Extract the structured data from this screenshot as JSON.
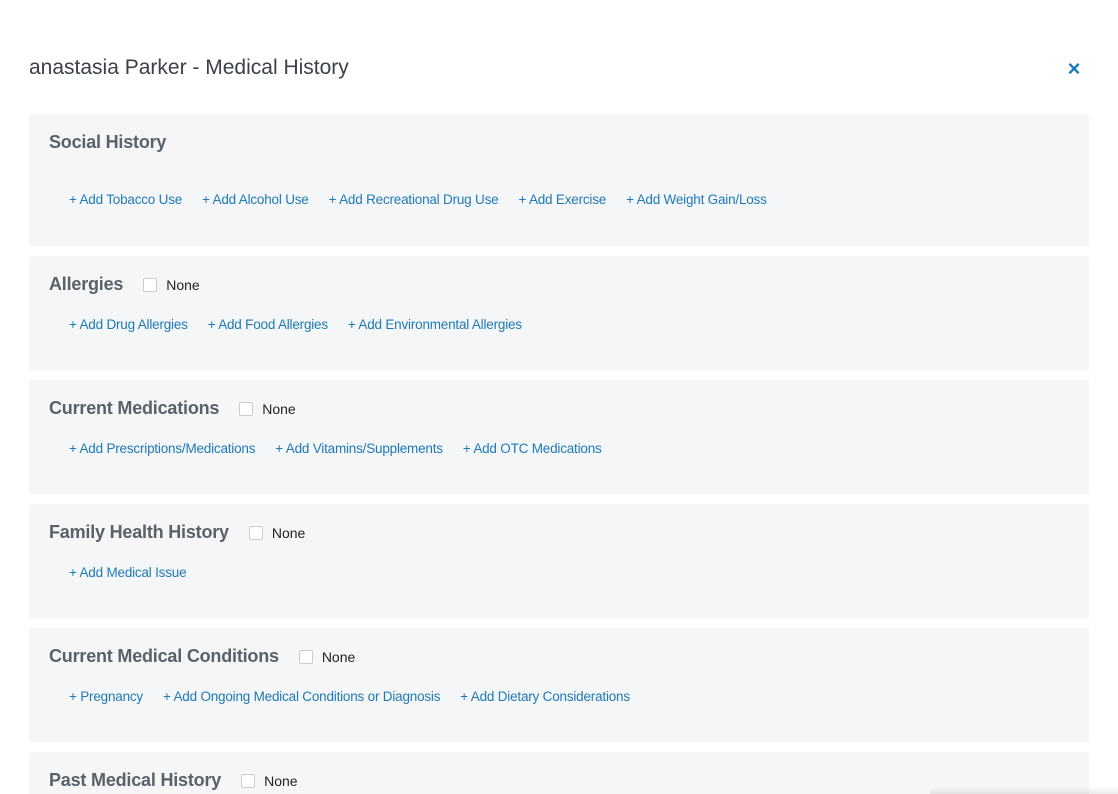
{
  "modal": {
    "title": "anastasia Parker - Medical History",
    "close_symbol": "×"
  },
  "sections": {
    "social": {
      "title": "Social History",
      "links": [
        "+ Add Tobacco Use",
        "+ Add Alcohol Use",
        "+ Add Recreational Drug Use",
        "+ Add Exercise",
        "+ Add Weight Gain/Loss"
      ]
    },
    "allergies": {
      "title": "Allergies",
      "none_label": "None",
      "links": [
        "+ Add Drug Allergies",
        "+ Add Food Allergies",
        "+ Add Environmental Allergies"
      ]
    },
    "medications": {
      "title": "Current Medications",
      "none_label": "None",
      "links": [
        "+ Add Prescriptions/Medications",
        "+ Add Vitamins/Supplements",
        "+ Add OTC Medications"
      ]
    },
    "family": {
      "title": "Family Health History",
      "none_label": "None",
      "links": [
        "+ Add Medical Issue"
      ]
    },
    "conditions": {
      "title": "Current Medical Conditions",
      "none_label": "None",
      "links": [
        "+ Pregnancy",
        "+ Add Ongoing Medical Conditions or Diagnosis",
        "+ Add Dietary Considerations"
      ]
    },
    "past": {
      "title": "Past Medical History",
      "none_label": "None"
    }
  },
  "colors": {
    "link": "#1e7ab7",
    "section_bg": "#f5f6f8",
    "title": "#3b4149"
  }
}
